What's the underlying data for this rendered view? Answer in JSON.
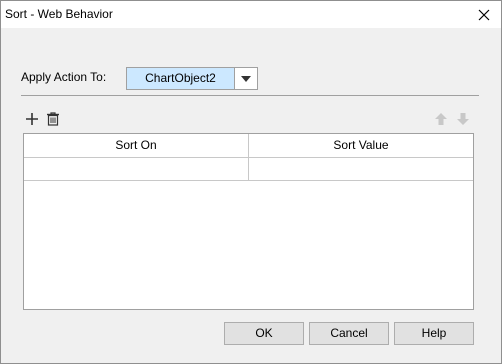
{
  "window": {
    "title": "Sort - Web Behavior",
    "close_icon": "close-icon"
  },
  "apply": {
    "label": "Apply Action To:",
    "selected": "ChartObject2",
    "arrow_icon": "chevron-down-icon"
  },
  "toolbar": {
    "add_icon": "plus-icon",
    "delete_icon": "trash-icon",
    "up_icon": "arrow-up-icon",
    "down_icon": "arrow-down-icon"
  },
  "grid": {
    "columns": [
      "Sort On",
      "Sort Value"
    ],
    "rows": [
      [
        "",
        ""
      ]
    ]
  },
  "buttons": {
    "ok": "OK",
    "cancel": "Cancel",
    "help": "Help"
  },
  "colors": {
    "selection": "#cce8ff",
    "disabled_icon": "#c8c8c8"
  }
}
